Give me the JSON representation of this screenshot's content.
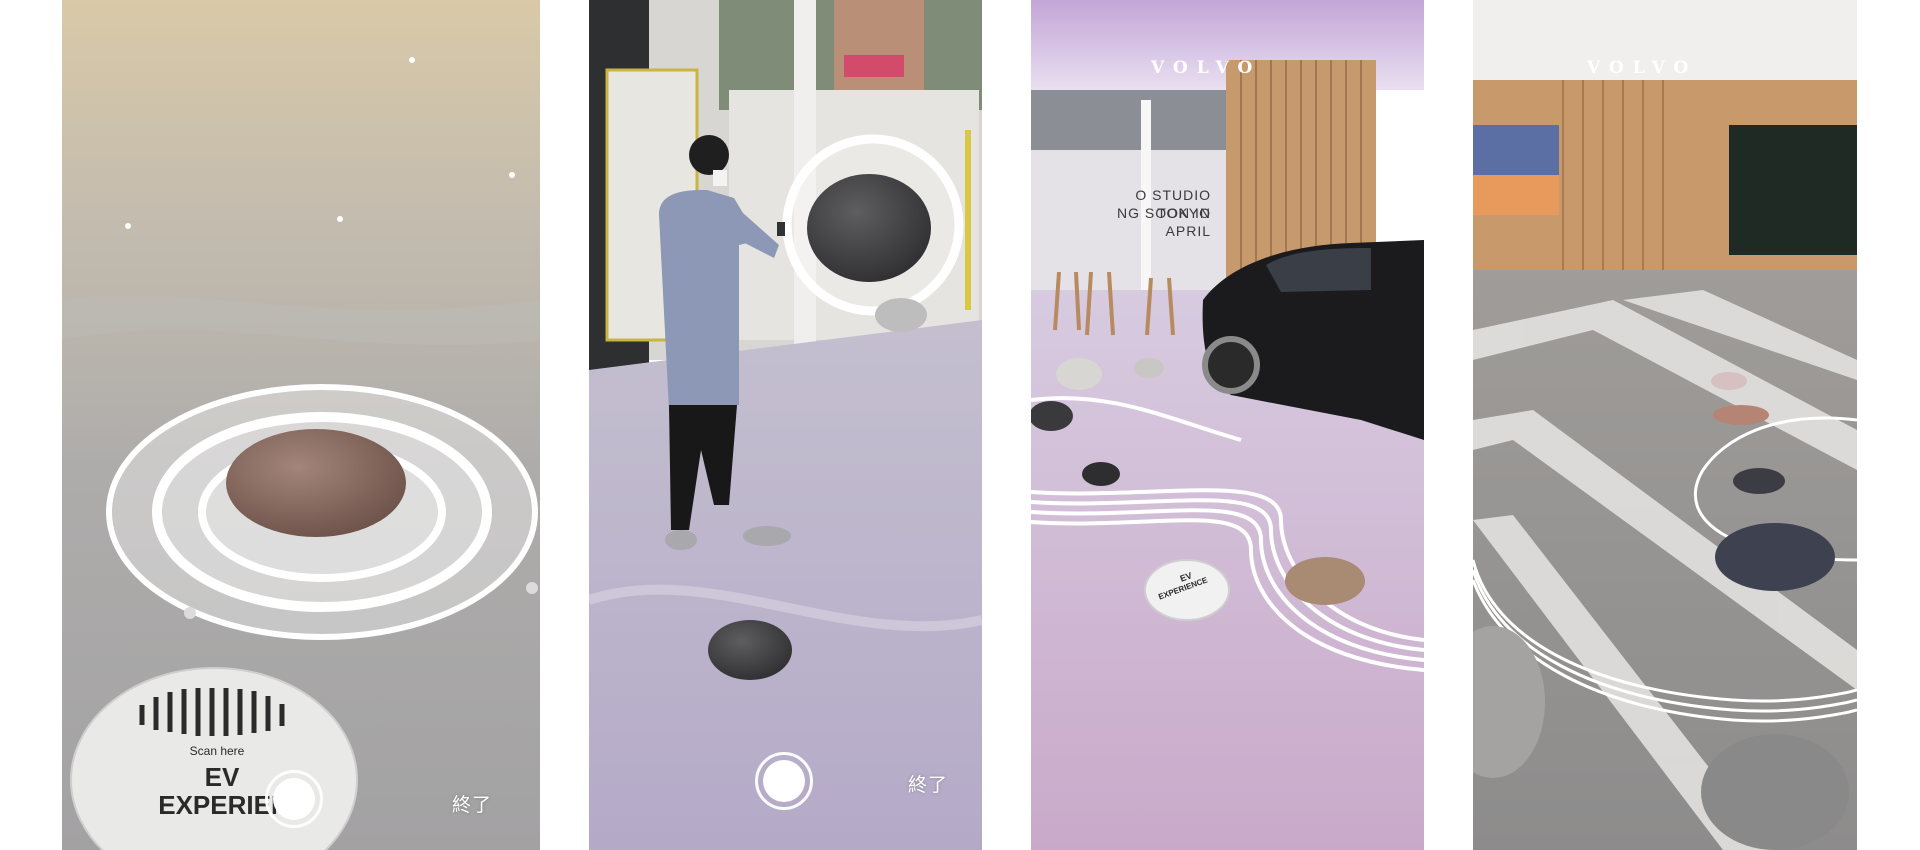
{
  "panels": [
    {
      "id": "panel-1",
      "marker_scan": "Scan here",
      "marker_title_1": "EV",
      "marker_title_2": "EXPERIEN",
      "exit_label": "終了"
    },
    {
      "id": "panel-2",
      "exit_label": "終了"
    },
    {
      "id": "panel-3",
      "brand": "VOLVO",
      "wall_line_1": "O STUDIO TOKYO",
      "wall_line_2": "NG SOON IN APRIL",
      "marker_line_1": "EV",
      "marker_line_2": "EXPERIENCE"
    },
    {
      "id": "panel-4",
      "brand": "VOLVO"
    }
  ],
  "colors": {
    "panel1_floor": "#b9b7b4",
    "panel2_floor": "#cdc6d8",
    "panel3_floor": "#d7c3da",
    "panel4_floor": "#c9c7c6",
    "stone_brown": "#8a6a5c",
    "stone_dark": "#4a4a4c",
    "car_black": "#1b1b1d",
    "wood": "#c69a6d"
  },
  "icons": [
    "shutter-button",
    "ar-ring-icon"
  ]
}
